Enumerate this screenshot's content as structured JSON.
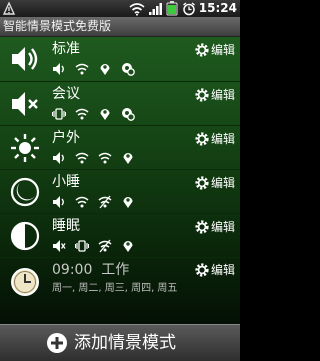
{
  "status": {
    "time": "15:24"
  },
  "app": {
    "title": "智能情景模式免费版"
  },
  "edit_label": "编辑",
  "modes": [
    {
      "name": "标准",
      "icon": "speaker-on-icon",
      "flags": [
        "ring-on-icon",
        "wifi-icon",
        "location-icon",
        "sync-icon"
      ]
    },
    {
      "name": "会议",
      "icon": "speaker-mute-icon",
      "flags": [
        "vibrate-icon",
        "wifi-icon",
        "location-icon",
        "sync-icon"
      ]
    },
    {
      "name": "户外",
      "icon": "sun-icon",
      "flags": [
        "ring-on-icon",
        "wifi-icon",
        "wifi-icon",
        "location-icon"
      ]
    },
    {
      "name": "小睡",
      "icon": "moon-icon",
      "flags": [
        "ring-on-icon",
        "wifi-icon",
        "wifi-off-icon",
        "location-icon"
      ]
    },
    {
      "name": "睡眠",
      "icon": "half-moon-icon",
      "flags": [
        "ring-mute-icon",
        "vibrate-icon",
        "wifi-off-icon",
        "location-icon"
      ]
    }
  ],
  "schedule": {
    "time": "09:00",
    "mode": "工作",
    "days": "周一, 周二, 周三, 周四, 周五"
  },
  "add_button": {
    "label": "添加情景模式"
  }
}
